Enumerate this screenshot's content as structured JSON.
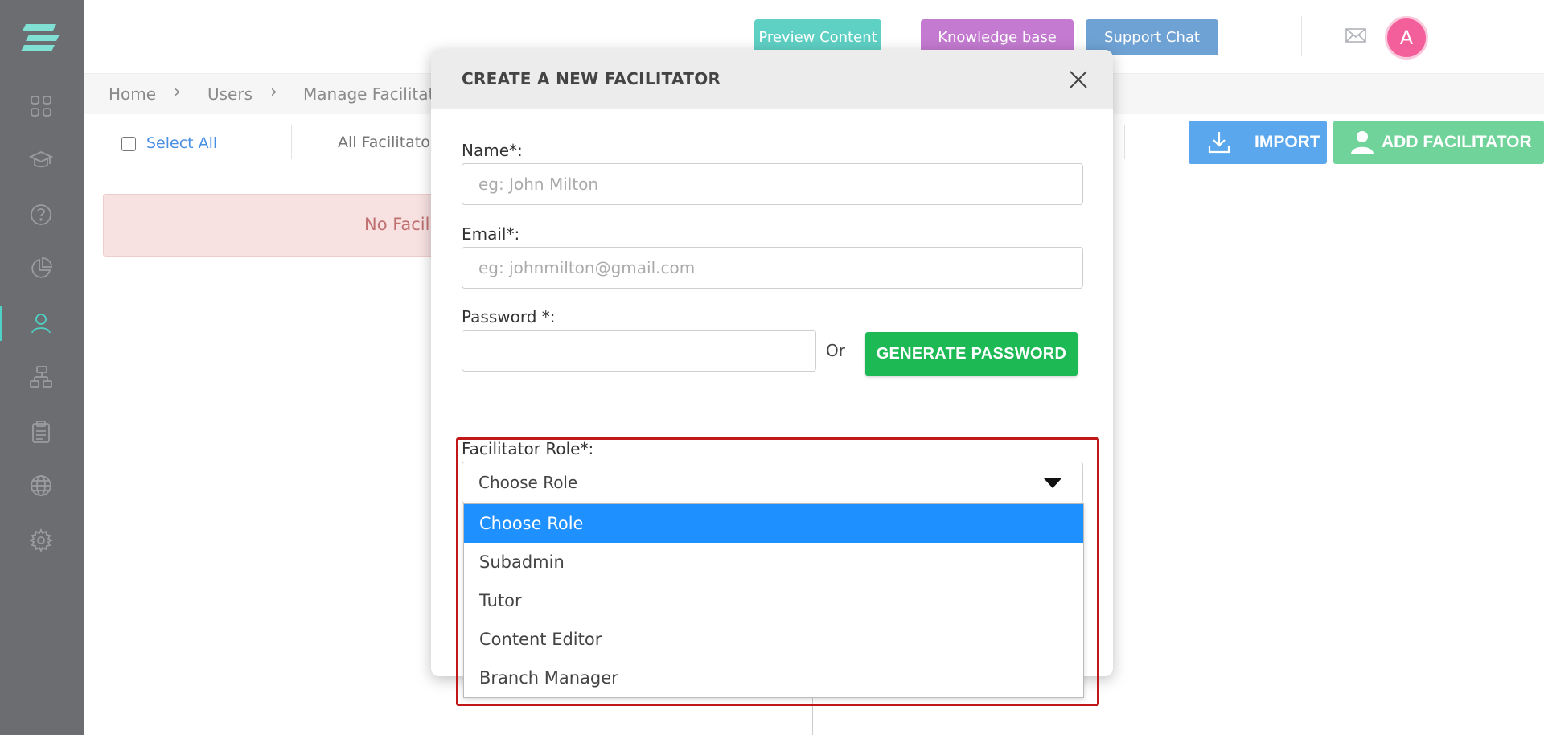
{
  "header": {
    "preview_label": "Preview Content",
    "knowledge_label": "Knowledge base",
    "support_label": "Support Chat",
    "avatar_initial": "A"
  },
  "breadcrumb": {
    "items": [
      "Home",
      "Users",
      "Manage Facilitato"
    ]
  },
  "toolbar": {
    "select_all_label": "Select All",
    "all_facilitators_label": "All Facilitator",
    "import_label": "IMPORT",
    "add_facilitator_label": "ADD FACILITATOR"
  },
  "alert": {
    "text": "No Facili"
  },
  "modal": {
    "title": "CREATE A NEW FACILITATOR",
    "name_label": "Name*:",
    "name_placeholder": "eg: John Milton",
    "email_label": "Email*:",
    "email_placeholder": "eg: johnmilton@gmail.com",
    "password_label": "Password *:",
    "or_label": "Or",
    "generate_label": "GENERATE PASSWORD",
    "role_label": "Facilitator Role*:",
    "role_selected": "Choose Role",
    "role_options": [
      "Choose Role",
      "Subadmin",
      "Tutor",
      "Content Editor",
      "Branch Manager"
    ]
  },
  "colors": {
    "sidebar_bg": "#6b6d70",
    "accent": "#4fd1c5",
    "highlight": "#c01818",
    "option_selected": "#1e90ff"
  }
}
